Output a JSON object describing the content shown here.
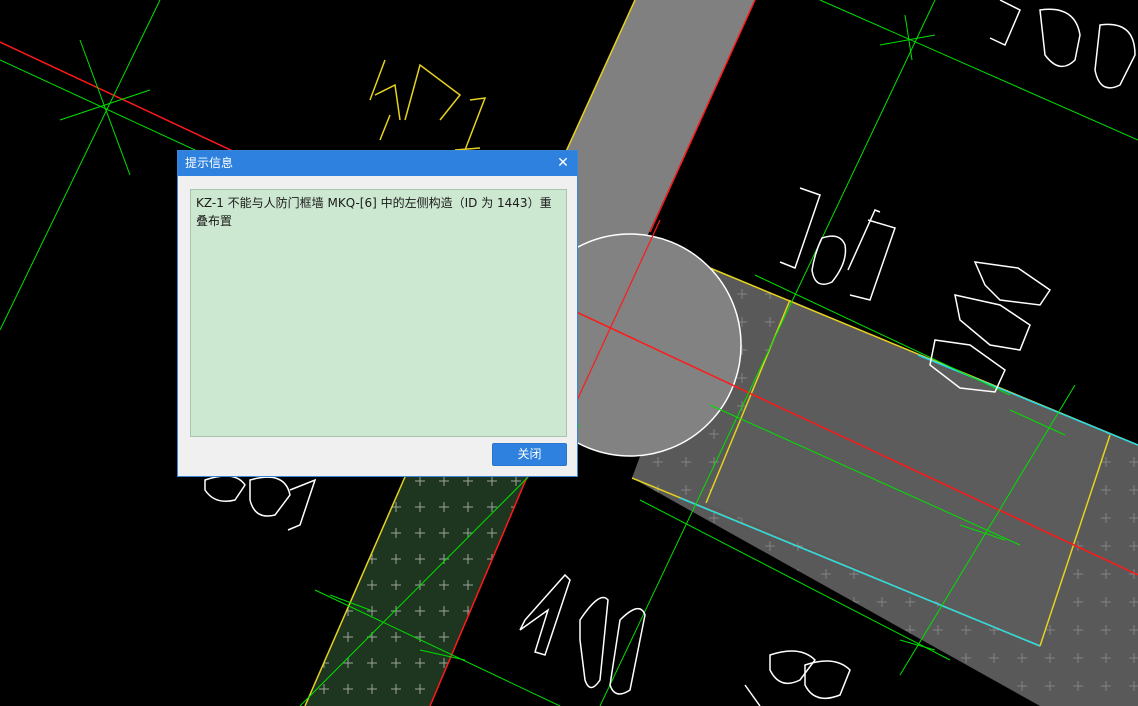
{
  "cad_canvas": {
    "labels": {
      "column_tag": "KZ1",
      "wall_index": "[6]",
      "dim_350": "350",
      "dim_400": "400",
      "dim_1000": "1000"
    },
    "colors": {
      "background": "#000000",
      "axis_line": "#ff1a1a",
      "grid_line": "#00e000",
      "wall_edge": "#e6d21e",
      "wall_fill": "#808080",
      "door_wall_fill": "#595959",
      "hatch_fill": "#1e3520",
      "annotation": "#ffffff",
      "cyan_edge": "#27d9e8"
    }
  },
  "dialog": {
    "title": "提示信息",
    "close_glyph": "✕",
    "message": "KZ-1 不能与人防门框墙 MKQ-[6] 中的左侧构造（ID 为 1443）重叠布置",
    "close_button_label": "关闭",
    "colors": {
      "titlebar": "#2e81de",
      "message_bg": "#cde8d1",
      "button": "#2e81de"
    }
  }
}
